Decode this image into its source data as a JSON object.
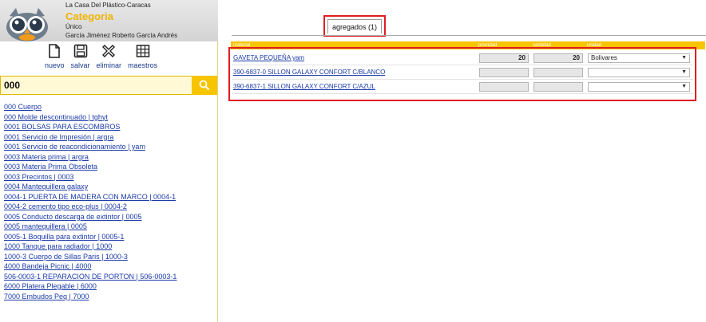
{
  "header": {
    "company": "La Casa Del Plástico-Caracas",
    "title": "Categoria",
    "line1": "Único",
    "user": "García Jiménez Roberto García Andrés"
  },
  "toolbar": {
    "nuevo": "nuevo",
    "salvar": "salvar",
    "eliminar": "eliminar",
    "maestros": "maestros"
  },
  "search": {
    "value": "000"
  },
  "results": [
    "000 Cuerpo",
    "000 Molde descontinuado | tghyt",
    "0001 BOLSAS PARA ESCOMBROS",
    "0001 Servicio de Impresión | argra",
    "0001 Servicio de reacondicionamiento | yam",
    "0003 Materia prima | argra",
    "0003 Materia Prima Obsoleta",
    "0003 Precintos | 0003",
    "0004 Mantequillera galaxy",
    "0004-1 PUERTA DE MADERA CON MARCO | 0004-1",
    "0004-2 cemento tipo eco-plus | 0004-2",
    "0005 Conducto descarga de extintor | 0005",
    "0005 mantequillera | 0005",
    "0005-1 Boquilla para extintor | 0005-1",
    "1000 Tanque para radiador | 1000",
    "1000-3 Cuerpo de Sillas Paris | 1000-3",
    "4000 Bandeja Picnic | 4000",
    "506-0003-1 REPARACION DE PORTON | 506-0003-1",
    "6000 Platera Plegable | 6000",
    "7000 Embudos Peq | 7000"
  ],
  "tab": {
    "label": "agregados (1)"
  },
  "table": {
    "headers": {
      "material": "material",
      "prioridad": "prioridad",
      "cantidad": "cantidad",
      "unidad": "unidad"
    },
    "rows": [
      {
        "material": "GAVETA PEQUEÑA yam",
        "prioridad": "20",
        "cantidad": "20",
        "unidad": "Bolivares"
      },
      {
        "material": "390-6837-0 SILLON GALAXY CONFORT C/BLANCO",
        "prioridad": "",
        "cantidad": "",
        "unidad": ""
      },
      {
        "material": "390-6837-1 SILLON GALAXY CONFORT C/AZUL",
        "prioridad": "",
        "cantidad": "",
        "unidad": ""
      }
    ]
  },
  "colors": {
    "accent": "#f7c400",
    "highlight": "#e01c24",
    "link": "#1a3aa8"
  }
}
